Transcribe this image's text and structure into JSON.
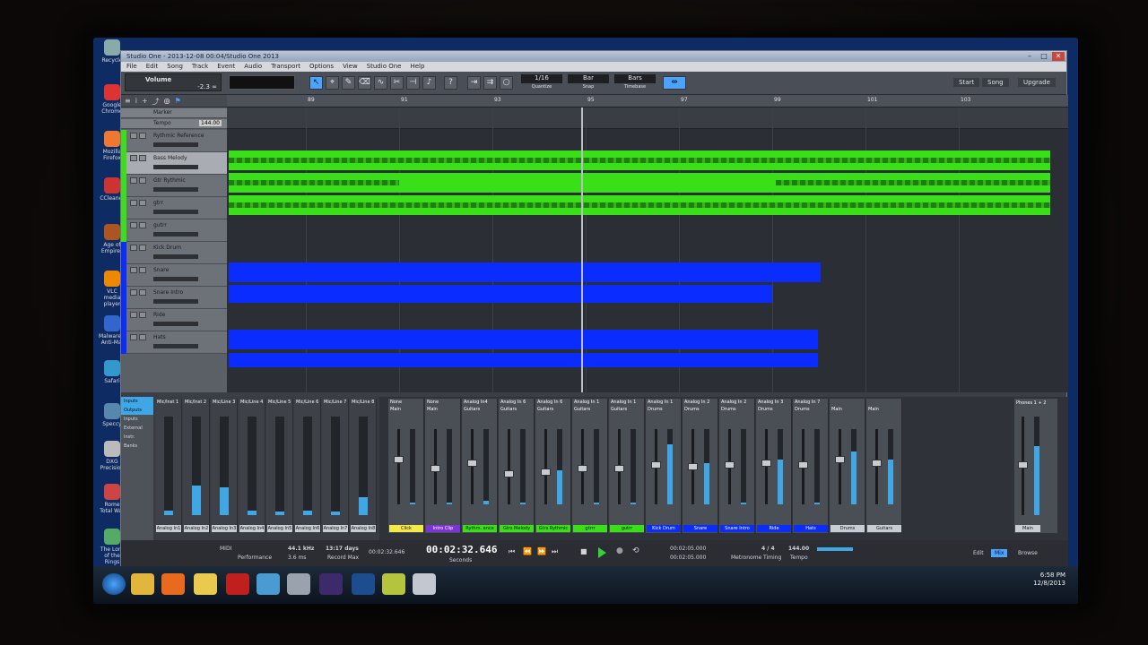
{
  "app_title": "Studio One - 2013-12-08 00:04/Studio One 2013",
  "window_controls": {
    "minimize": "–",
    "maximize": "□",
    "close": "✕"
  },
  "menu": [
    "File",
    "Edit",
    "Song",
    "Track",
    "Event",
    "Audio",
    "Transport",
    "Options",
    "View",
    "Studio One",
    "Help"
  ],
  "inspector": {
    "name": "Volume",
    "value": "-2.3 ∞"
  },
  "quantize": {
    "value": "1/16",
    "label": "Quantize"
  },
  "snap": {
    "value": "Bar",
    "label": "Snap"
  },
  "timebase": {
    "value": "Bars",
    "label": "Timebase"
  },
  "top_right": {
    "start": "Start",
    "song": "Song",
    "upgrade": "Upgrade"
  },
  "ruler_marks": [
    "89",
    "91",
    "93",
    "95",
    "97",
    "99",
    "101",
    "103"
  ],
  "global_tracks": {
    "marker_label": "Marker",
    "tempo_label": "Tempo",
    "tempo_value": "144.00"
  },
  "tracks": [
    {
      "name": "Rythmic Reference",
      "color": "#39e018"
    },
    {
      "name": "Bass Melody",
      "color": "#39e018"
    },
    {
      "name": "Gtr Rythmic",
      "color": "#39e018"
    },
    {
      "name": "gtrr",
      "color": "#39e018"
    },
    {
      "name": "gutrr",
      "color": "#39e018"
    },
    {
      "name": "Kick Drum",
      "color": "#0b2cff"
    },
    {
      "name": "Snare",
      "color": "#0b2cff"
    },
    {
      "name": "Snare Intro",
      "color": "#0b2cff"
    },
    {
      "name": "Ride",
      "color": "#0b2cff"
    },
    {
      "name": "Hats",
      "color": "#0b2cff"
    }
  ],
  "mixer_side": [
    "Inputs",
    "Outputs",
    "Inputs",
    "External",
    "Instr.",
    "Banks"
  ],
  "input_strips": [
    {
      "name": "Mic/Inst 1",
      "chan": "Analog In1"
    },
    {
      "name": "Mic/Inst 2",
      "chan": "Analog In2"
    },
    {
      "name": "Mic/Line 3",
      "chan": "Analog In3"
    },
    {
      "name": "Mic/Line 4",
      "chan": "Analog In4"
    },
    {
      "name": "Mic/Line 5",
      "chan": "Analog In5"
    },
    {
      "name": "Mic/Line 6",
      "chan": "Analog In6"
    },
    {
      "name": "Mic/Line 7",
      "chan": "Analog In7"
    },
    {
      "name": "Mic/Line 8",
      "chan": "Analog In8"
    }
  ],
  "channel_strips": [
    {
      "in": "None",
      "out": "Main",
      "name": "Click",
      "color": "#f4e94a"
    },
    {
      "in": "None",
      "out": "Main",
      "name": "Intro Clip",
      "color": "#7c34d8"
    },
    {
      "in": "Analog In4",
      "out": "Guitars",
      "name": "Rythm. ence",
      "color": "#39e018"
    },
    {
      "in": "Analog In 6",
      "out": "Guitars",
      "name": "Gtrs Melody",
      "color": "#39e018"
    },
    {
      "in": "Analog In 6",
      "out": "Guitars",
      "name": "Gtrs Rythmic",
      "color": "#39e018"
    },
    {
      "in": "Analog In 1",
      "out": "Guitars",
      "name": "gtrrr",
      "color": "#39e018"
    },
    {
      "in": "Analog In 1",
      "out": "Guitars",
      "name": "gutrr",
      "color": "#39e018"
    },
    {
      "in": "Analog In 1",
      "out": "Drums",
      "name": "Kick Drum",
      "color": "#0b2cff"
    },
    {
      "in": "Analog In 2",
      "out": "Drums",
      "name": "Snare",
      "color": "#0b2cff"
    },
    {
      "in": "Analog In 2",
      "out": "Drums",
      "name": "Snare Intro",
      "color": "#0b2cff"
    },
    {
      "in": "Analog In 3",
      "out": "Drums",
      "name": "Ride",
      "color": "#0b2cff"
    },
    {
      "in": "Analog In 7",
      "out": "Drums",
      "name": "Hats",
      "color": "#0b2cff"
    },
    {
      "in": "",
      "out": "Main",
      "name": "Drums",
      "color": "#c9ccd2"
    },
    {
      "in": "",
      "out": "Main",
      "name": "Guitars",
      "color": "#c9ccd2"
    }
  ],
  "main_out": {
    "name": "Phones 1 + 2",
    "label": "Main"
  },
  "transport": {
    "midi": "MIDI",
    "performance": "Performance",
    "sample_rate": "44.1 kHz",
    "latency": "3.6 ms",
    "record_max_label": "Record Max",
    "record_max": "13:17 days",
    "seconds_small": "00:02:32.646",
    "time": "00:02:32.646",
    "time_unit": "Seconds",
    "loop_start": "00:02:05.000",
    "loop_end": "00:02:05.000",
    "metronome": "Metronome",
    "timesig": "4 / 4",
    "timing_label": "Timing",
    "tempo": "144.00",
    "tempo_label": "Tempo"
  },
  "view_buttons": {
    "edit": "Edit",
    "mix": "Mix",
    "browse": "Browse"
  },
  "clock": {
    "time": "6:58 PM",
    "date": "12/8/2013"
  }
}
